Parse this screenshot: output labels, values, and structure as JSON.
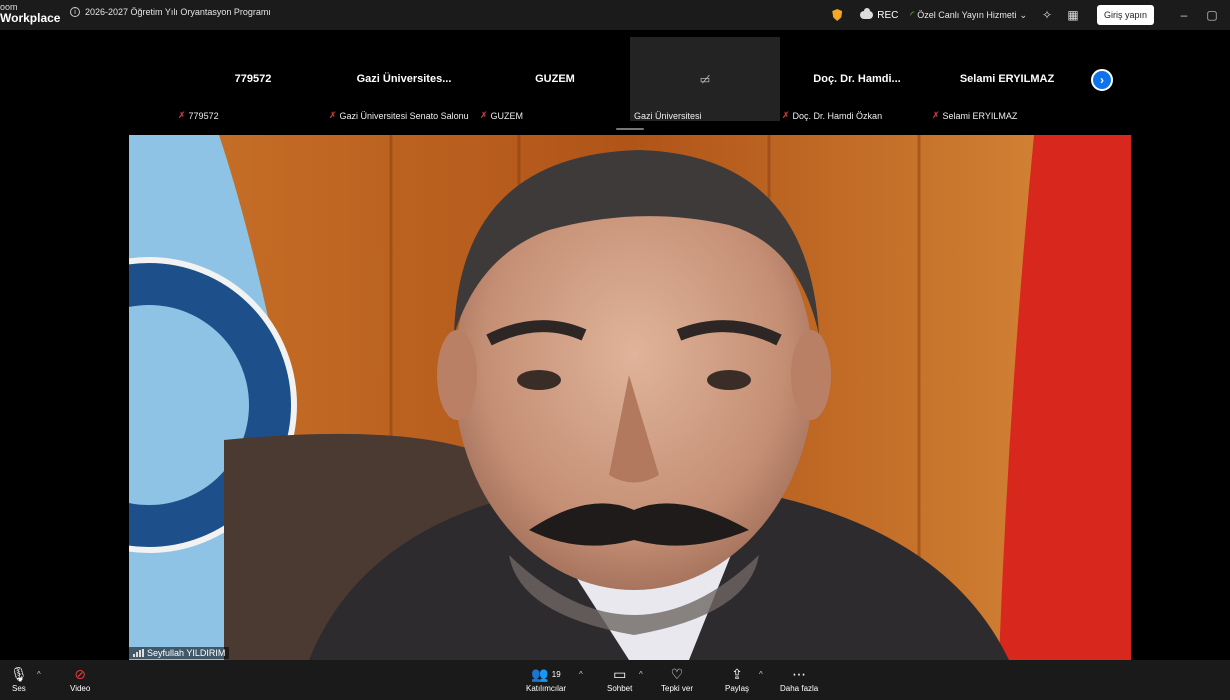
{
  "app": {
    "brand_small": "oom",
    "brand_big": "Workplace"
  },
  "meeting": {
    "title": "2026-2027 Öğretim Yılı Oryantasyon Programı"
  },
  "topbar": {
    "rec_label": "REC",
    "live_label": "Özel Canlı Yayın Hizmeti",
    "signin_label": "Giriş yapın"
  },
  "participants": [
    {
      "name": "779572",
      "label": "779572"
    },
    {
      "name": "Gazi Üniversites...",
      "label": "Gazi Üniversitesi Senato Salonu"
    },
    {
      "name": "GUZEM",
      "label": "GUZEM"
    },
    {
      "name": "",
      "label": "Gazi Üniversitesi"
    },
    {
      "name": "Doç. Dr. Hamdi...",
      "label": "Doç. Dr. Hamdi Özkan"
    },
    {
      "name": "Selami ERYILMAZ",
      "label": "Selami ERYILMAZ"
    }
  ],
  "active_speaker": "Seyfullah YILDIRIM",
  "toolbar": {
    "audio": "Ses",
    "video": "Video",
    "participants": "Katılımcılar",
    "participants_count": "19",
    "chat": "Sohbet",
    "react": "Tepki ver",
    "share": "Paylaş",
    "more": "Daha fazla"
  },
  "colors": {
    "accent": "#0e72ed",
    "rec_shield": "#f5a623",
    "mute_red": "#e23c3c"
  }
}
